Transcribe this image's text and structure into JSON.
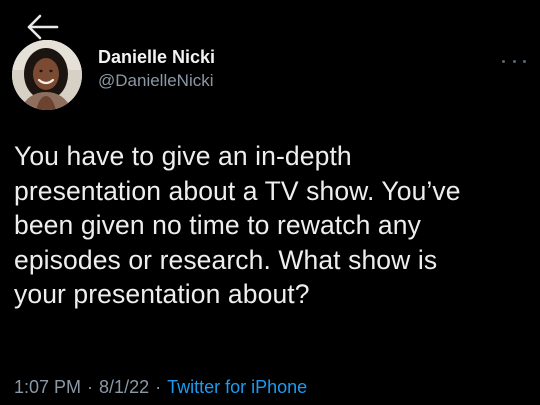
{
  "navigation": {
    "back_icon": "arrow-left-icon"
  },
  "author": {
    "display_name": "Danielle Nicki",
    "handle": "@DanielleNicki",
    "avatar_icon": "user-avatar"
  },
  "more_icon": "more-horizontal-icon",
  "tweet": {
    "text": "You have to give an in-depth\npresentation about a TV show. You’ve\nbeen given no time to rewatch any\nepisodes or research. What show is\nyour presentation about?"
  },
  "meta": {
    "time": "1:07 PM",
    "separator": "·",
    "date": "8/1/22",
    "source": "Twitter for iPhone"
  },
  "colors": {
    "background": "#000000",
    "text": "#e7e9ea",
    "muted": "#8b98a5",
    "link": "#1d9bf0"
  }
}
